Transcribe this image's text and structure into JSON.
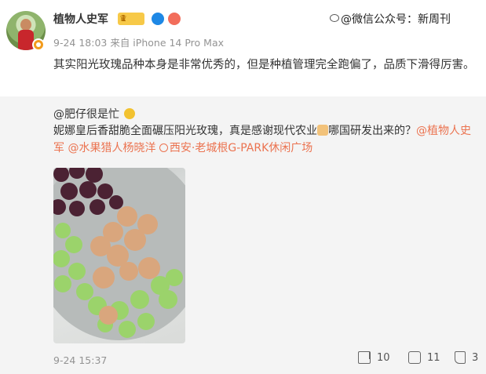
{
  "post": {
    "author": "植物人史军",
    "badge_level": "1",
    "meta": "9-24 18:03  来自 iPhone 14 Pro Max",
    "text": "其实阳光玫瑰品种本身是非常优秀的，但是种植管理完全跑偏了，品质下滑得厉害。"
  },
  "watermark": "@微信公众号：新周刊",
  "repost": {
    "user": "@肥仔很是忙",
    "text_before_thumb": "妮娜皇后香甜脆全面碾压阳光玫瑰，真是感谢现代农业",
    "text_after_thumb": "哪国研发出来的？",
    "mention1": "@植物人史军",
    "mention2": "@水果猎人杨晓洋",
    "location": "西安·老城根G-PARK休闲广场",
    "time": "9-24 15:37",
    "share_count": "10",
    "comment_count": "11",
    "like_count": "3"
  },
  "icons": {
    "verify": "orange-verified-icon",
    "crown": "vip-crown-icon",
    "share": "share-icon",
    "comment": "comment-icon",
    "like": "thumbs-up-icon"
  },
  "colors": {
    "link": "#eb7350",
    "repost_bg": "#f4f4f4",
    "meta": "#939393"
  }
}
